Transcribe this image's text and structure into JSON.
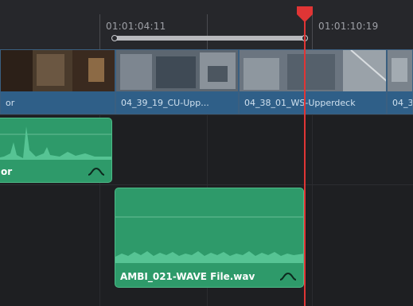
{
  "ruler": {
    "timecodes": [
      "01:01:04:11",
      "01:01:10:19"
    ]
  },
  "video_track": {
    "clips": [
      {
        "label": "or"
      },
      {
        "label": "04_39_19_CU-Upp..."
      },
      {
        "label": "04_38_01_WS-Upperdeck"
      },
      {
        "label": "04_3"
      }
    ]
  },
  "audio_track_1": {
    "clip": {
      "label": "or"
    }
  },
  "audio_track_2": {
    "clip": {
      "label": "AMBI_021-WAVE File.wav"
    }
  },
  "colors": {
    "playhead": "#e03535",
    "video_clip": "#2f5f88",
    "audio_clip": "#2e9a6a"
  },
  "icons": [
    "playhead-marker-icon",
    "volume-curve-icon"
  ]
}
